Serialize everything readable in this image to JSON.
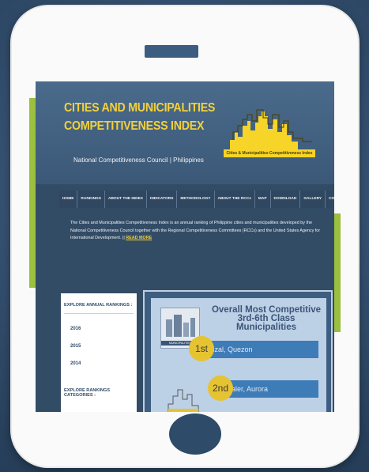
{
  "site": {
    "title_line1": "CITIES AND MUNICIPALITIES",
    "title_line2": "COMPETITIVENESS INDEX",
    "subtitle": "National Competitiveness Council | Philippines",
    "logo_text": "Cities & Municipalities Competitiveness Index"
  },
  "nav": {
    "items": [
      "HOME",
      "RANKINGS",
      "ABOUT THE INDEX",
      "INDICATORS",
      "METHODOLOGY",
      "ABOUT THE RCCs",
      "MAP",
      "DOWNLOAD",
      "GALLERY",
      "CONTACT US"
    ]
  },
  "intro": {
    "text": "The Cities and Municipalities Competitiveness Index is an annual ranking of Philippine cities and municipalities developed by the National Competitiveness Council together with the Regional Competitiveness Committees (RCCs) and the United States Agency for International Development. || ",
    "read_more": "READ MORE"
  },
  "sidebar": {
    "rankings_heading": "EXPLORE ANNUAL RANKINGS :",
    "years": [
      "2016",
      "2015",
      "2014"
    ],
    "categories_heading": "EXPLORE RANKINGS CATEGORIES :"
  },
  "feature": {
    "title_line1": "Overall Most Competitive",
    "title_line2": "3rd-6th Class Municipalities",
    "thumb_label": "MUNICIPALITIES",
    "ranks": [
      {
        "place": "1st",
        "name": "Rizal, Quezon"
      },
      {
        "place": "2nd",
        "name": "Baler, Aurora"
      }
    ]
  },
  "colors": {
    "accent_yellow": "#f3d13a",
    "nav_bg": "#2f4761",
    "device_frame": "#fafafa"
  }
}
